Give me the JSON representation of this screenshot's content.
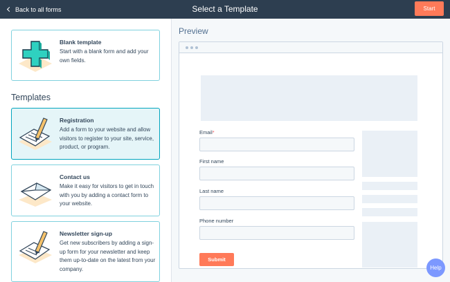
{
  "topbar": {
    "back_label": "Back to all forms",
    "title": "Select a Template",
    "start_label": "Start"
  },
  "blank": {
    "title": "Blank template",
    "desc": "Start with a blank form and add your own fields."
  },
  "templates_heading": "Templates",
  "templates": [
    {
      "title": "Registration",
      "desc": "Add a form to your website and allow visitors to register to your site, service, product, or program.",
      "icon": "registration-icon"
    },
    {
      "title": "Contact us",
      "desc": "Make it easy for visitors to get in touch with you by adding a contact form to your website.",
      "icon": "envelope-icon"
    },
    {
      "title": "Newsletter sign-up",
      "desc": "Get new subscribers by adding a sign-up form for your newsletter and keep them up-to-date on the latest from your company.",
      "icon": "newsletter-icon"
    }
  ],
  "preview": {
    "heading": "Preview",
    "fields": [
      {
        "label": "Email",
        "required_mark": "*"
      },
      {
        "label": "First name"
      },
      {
        "label": "Last name"
      },
      {
        "label": "Phone number"
      }
    ],
    "submit_label": "Submit"
  },
  "help_label": "Help",
  "colors": {
    "topbar": "#2d3e50",
    "accent_orange": "#ff7a59",
    "selected_border": "#00a4bd",
    "help": "#7c98ff"
  }
}
